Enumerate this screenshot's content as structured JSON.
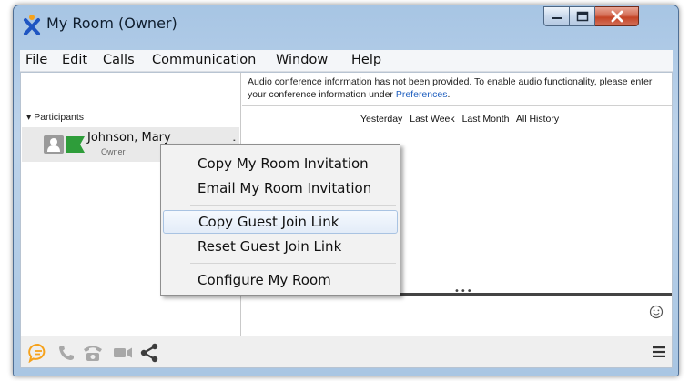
{
  "window": {
    "title": "My Room (Owner)"
  },
  "menu": {
    "items": [
      "File",
      "Edit",
      "Calls",
      "Communication",
      "Window",
      "Help"
    ]
  },
  "participants": {
    "header": "Participants",
    "list": [
      {
        "name": "Johnson, Mary",
        "role": "Owner"
      }
    ]
  },
  "audio_notice": {
    "text": "Audio conference information has not been provided. To enable audio functionality, please enter your conference information under ",
    "link": "Preferences",
    "suffix": "."
  },
  "history": {
    "links": [
      "Yesterday",
      "Last Week",
      "Last Month",
      "All History"
    ]
  },
  "context_menu": {
    "items": [
      {
        "label": "Copy My Room Invitation",
        "highlighted": false
      },
      {
        "label": "Email My Room Invitation",
        "highlighted": false
      },
      {
        "label": "Copy Guest Join Link",
        "highlighted": true
      },
      {
        "label": "Reset Guest Join Link",
        "highlighted": false
      },
      {
        "label": "Configure My Room",
        "highlighted": false
      }
    ]
  },
  "icons": {
    "app": "jabber-x-icon",
    "bottom_bar": [
      "chat-icon",
      "phone-icon",
      "desk-phone-icon",
      "video-icon",
      "share-icon",
      "hamburger-menu-icon"
    ]
  },
  "colors": {
    "accent_orange": "#f6a21c",
    "presence_green": "#2e9d3a",
    "link_blue": "#1f5fbf",
    "icon_gray": "#a8a8a8"
  }
}
